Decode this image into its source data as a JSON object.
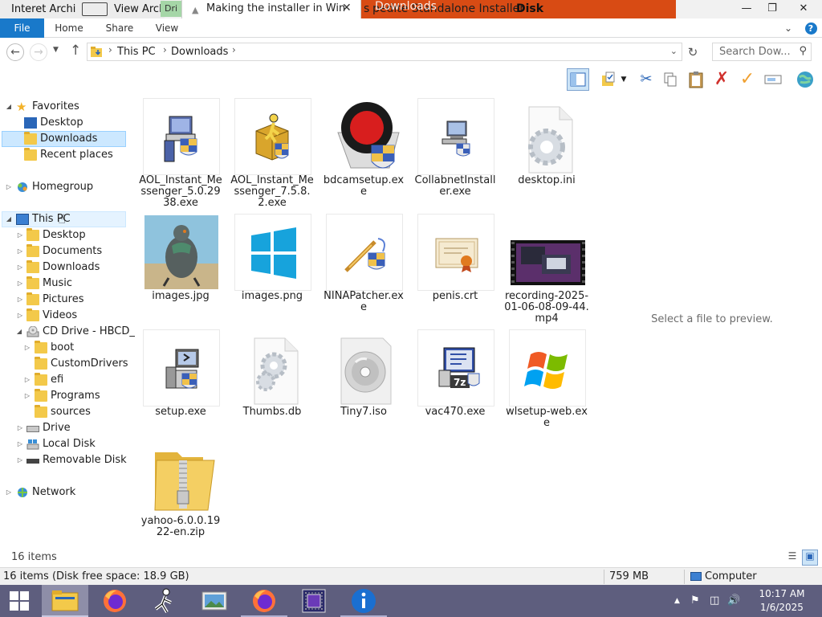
{
  "titlebar": {
    "left_fragment": "Interet Archi",
    "left_fragment_2": "View Arch",
    "green_tab": "Dri",
    "active_tab_title": "Making the installer in Win",
    "orange_fragment_a": "s",
    "orange_fragment_b": "Downloads",
    "orange_fragment_c": "Disk",
    "orange_title": "pedite Standalone Installer"
  },
  "ribbon": {
    "tabs": [
      "File",
      "Home",
      "Share",
      "View"
    ]
  },
  "address": {
    "crumbs": [
      "This PC",
      "Downloads"
    ],
    "search_placeholder": "Search Dow..."
  },
  "tree": {
    "items": [
      {
        "label": "Favorites"
      },
      {
        "label": "Desktop"
      },
      {
        "label": "Downloads"
      },
      {
        "label": "Recent places"
      },
      {
        "label": "Homegroup"
      },
      {
        "label": "This PC"
      },
      {
        "label": "Desktop"
      },
      {
        "label": "Documents"
      },
      {
        "label": "Downloads"
      },
      {
        "label": "Music"
      },
      {
        "label": "Pictures"
      },
      {
        "label": "Videos"
      },
      {
        "label": "CD Drive - HBCD_"
      },
      {
        "label": "boot"
      },
      {
        "label": "CustomDrivers"
      },
      {
        "label": "efi"
      },
      {
        "label": "Programs"
      },
      {
        "label": "sources"
      },
      {
        "label": "Drive"
      },
      {
        "label": "Local Disk"
      },
      {
        "label": "Removable Disk"
      },
      {
        "label": "Network"
      }
    ]
  },
  "files": [
    {
      "name": "AOL_Instant_Messenger_5.0.2938.exe",
      "icon": "installer-icon"
    },
    {
      "name": "AOL_Instant_Messenger_7.5.8.2.exe",
      "icon": "aim-installer-icon"
    },
    {
      "name": "bdcamsetup.exe",
      "icon": "bandicam-icon"
    },
    {
      "name": "CollabnetInstaller.exe",
      "icon": "computer-installer-icon"
    },
    {
      "name": "desktop.ini",
      "icon": "settings-file-icon"
    },
    {
      "name": "images.jpg",
      "icon": "pigeon-photo-thumbnail"
    },
    {
      "name": "images.png",
      "icon": "windows-logo-thumbnail"
    },
    {
      "name": "NINAPatcher.exe",
      "icon": "wand-shield-icon"
    },
    {
      "name": "penis.crt",
      "icon": "certificate-icon"
    },
    {
      "name": "recording-2025-01-06-08-09-44.mp4",
      "icon": "video-thumbnail"
    },
    {
      "name": "setup.exe",
      "icon": "setup-installer-icon"
    },
    {
      "name": "Thumbs.db",
      "icon": "settings-file-icon"
    },
    {
      "name": "Tiny7.iso",
      "icon": "disc-image-icon"
    },
    {
      "name": "vac470.exe",
      "icon": "7zip-installer-icon"
    },
    {
      "name": "wlsetup-web.exe",
      "icon": "windows-flag-icon"
    },
    {
      "name": "yahoo-6.0.0.1922-en.zip",
      "icon": "zip-folder-icon"
    }
  ],
  "preview": {
    "message": "Select a file to preview."
  },
  "status": {
    "count_text": "16 items",
    "left": "16 items (Disk free space: 18.9 GB)",
    "size": "759 MB",
    "zone": "Computer"
  },
  "taskbar": {
    "apps": [
      "file-explorer",
      "firefox",
      "aim",
      "photo-viewer",
      "firefox",
      "cpu-z",
      "info"
    ],
    "time": "10:17 AM",
    "date": "1/6/2025"
  },
  "colors": {
    "accent": "#1979ca",
    "selection": "#cce8ff",
    "taskbar": "#5e5e7e",
    "orange_window": "#d84b14"
  }
}
